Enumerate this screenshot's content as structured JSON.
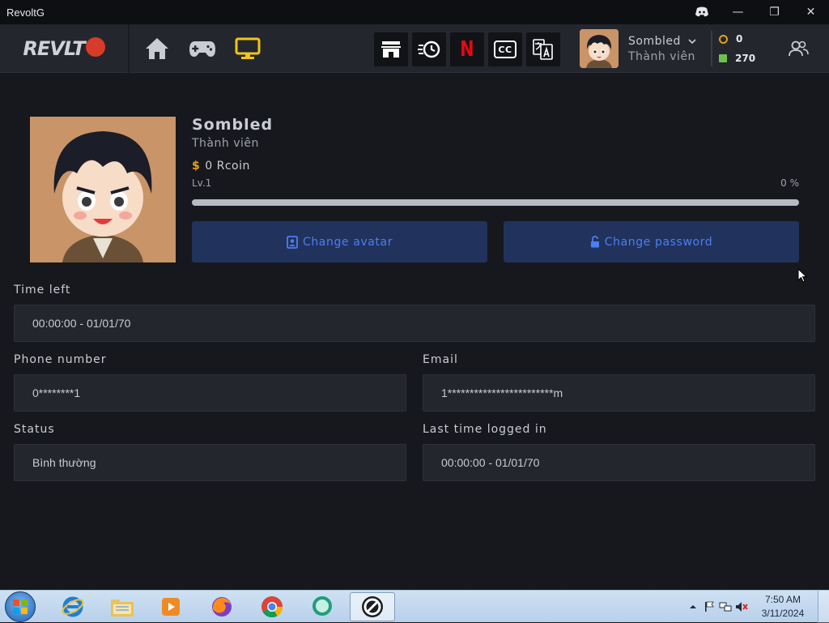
{
  "window": {
    "title": "RevoltG",
    "controls": {
      "minimize": "—",
      "restore": "❐",
      "close": "✕"
    }
  },
  "nav": {
    "logo_text": "REVLT",
    "icons": [
      "home-icon",
      "gamepad-icon",
      "monitor-icon"
    ],
    "active_icon": "monitor-icon",
    "tools": [
      "store-icon",
      "history-icon",
      "netflix-icon",
      "closed-captions-icon",
      "translate-icon"
    ],
    "netflix_letter": "N",
    "cc_text": "CC"
  },
  "user": {
    "name": "Sombled",
    "role": "Thành viên",
    "coins": "0",
    "points": "270"
  },
  "profile": {
    "name": "Sombled",
    "role": "Thành viên",
    "rcoin": "0 Rcoin",
    "currency_symbol": "$",
    "level": "Lv.1",
    "progress_percent": "0 %",
    "progress_value": 0,
    "change_avatar": "Change avatar",
    "change_password": "Change password"
  },
  "fields": {
    "time_left_label": "Time left",
    "time_left_value": "00:00:00 - 01/01/70",
    "phone_label": "Phone number",
    "phone_value": "0********1",
    "email_label": "Email",
    "email_value": "1************************m",
    "status_label": "Status",
    "status_value": "Bình thường",
    "last_login_label": "Last time logged in",
    "last_login_value": "00:00:00 - 01/01/70"
  },
  "taskbar": {
    "apps": [
      "internet-explorer",
      "file-explorer",
      "media-player",
      "firefox",
      "chrome",
      "chat-app",
      "revoltg"
    ],
    "active_app": "revoltg",
    "time": "7:50 AM",
    "date": "3/11/2024"
  },
  "colors": {
    "accent": "#4b7ff2",
    "button_bg": "#21325c",
    "active_nav": "#f0c419",
    "netflix": "#e50914",
    "coin": "#e3a11a",
    "point": "#6cc24a"
  }
}
